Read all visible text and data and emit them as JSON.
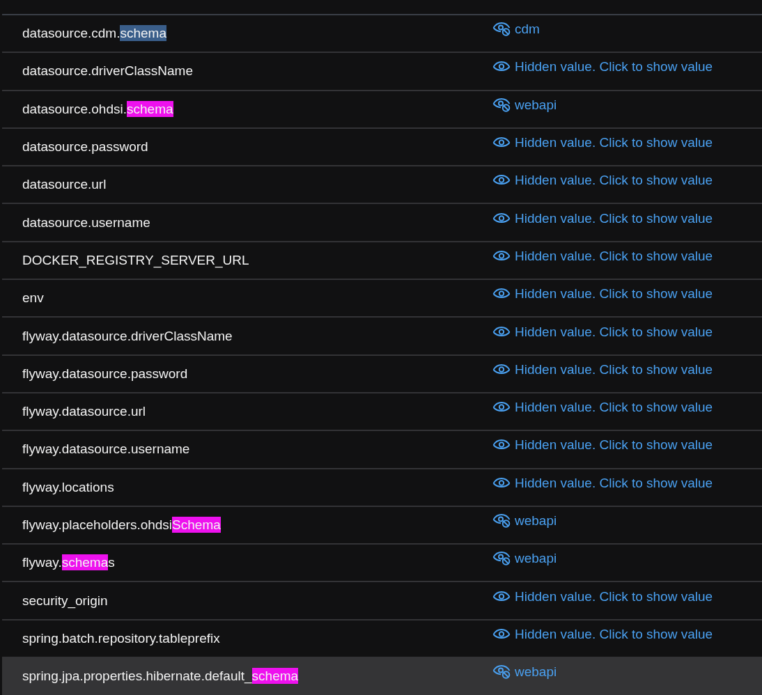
{
  "settings": [
    {
      "selected": false,
      "name": [
        {
          "text": "datasource.cdm.",
          "kind": "plain"
        },
        {
          "text": "schema",
          "kind": "current"
        }
      ],
      "value": {
        "hidden": false,
        "text": "cdm"
      }
    },
    {
      "selected": false,
      "name": [
        {
          "text": "datasource.driverClassName",
          "kind": "plain"
        }
      ],
      "value": {
        "hidden": true,
        "text": "Hidden value. Click to show value"
      }
    },
    {
      "selected": false,
      "name": [
        {
          "text": "datasource.ohdsi.",
          "kind": "plain"
        },
        {
          "text": "schema",
          "kind": "match"
        }
      ],
      "value": {
        "hidden": false,
        "text": "webapi"
      }
    },
    {
      "selected": false,
      "name": [
        {
          "text": "datasource.password",
          "kind": "plain"
        }
      ],
      "value": {
        "hidden": true,
        "text": "Hidden value. Click to show value"
      }
    },
    {
      "selected": false,
      "name": [
        {
          "text": "datasource.url",
          "kind": "plain"
        }
      ],
      "value": {
        "hidden": true,
        "text": "Hidden value. Click to show value"
      }
    },
    {
      "selected": false,
      "name": [
        {
          "text": "datasource.username",
          "kind": "plain"
        }
      ],
      "value": {
        "hidden": true,
        "text": "Hidden value. Click to show value"
      }
    },
    {
      "selected": false,
      "name": [
        {
          "text": "DOCKER_REGISTRY_SERVER_URL",
          "kind": "plain"
        }
      ],
      "value": {
        "hidden": true,
        "text": "Hidden value. Click to show value"
      }
    },
    {
      "selected": false,
      "name": [
        {
          "text": "env",
          "kind": "plain"
        }
      ],
      "value": {
        "hidden": true,
        "text": "Hidden value. Click to show value"
      }
    },
    {
      "selected": false,
      "name": [
        {
          "text": "flyway.datasource.driverClassName",
          "kind": "plain"
        }
      ],
      "value": {
        "hidden": true,
        "text": "Hidden value. Click to show value"
      }
    },
    {
      "selected": false,
      "name": [
        {
          "text": "flyway.datasource.password",
          "kind": "plain"
        }
      ],
      "value": {
        "hidden": true,
        "text": "Hidden value. Click to show value"
      }
    },
    {
      "selected": false,
      "name": [
        {
          "text": "flyway.datasource.url",
          "kind": "plain"
        }
      ],
      "value": {
        "hidden": true,
        "text": "Hidden value. Click to show value"
      }
    },
    {
      "selected": false,
      "name": [
        {
          "text": "flyway.datasource.username",
          "kind": "plain"
        }
      ],
      "value": {
        "hidden": true,
        "text": "Hidden value. Click to show value"
      }
    },
    {
      "selected": false,
      "name": [
        {
          "text": "flyway.locations",
          "kind": "plain"
        }
      ],
      "value": {
        "hidden": true,
        "text": "Hidden value. Click to show value"
      }
    },
    {
      "selected": false,
      "name": [
        {
          "text": "flyway.placeholders.ohdsi",
          "kind": "plain"
        },
        {
          "text": "Schema",
          "kind": "match"
        }
      ],
      "value": {
        "hidden": false,
        "text": "webapi"
      }
    },
    {
      "selected": false,
      "name": [
        {
          "text": "flyway.",
          "kind": "plain"
        },
        {
          "text": "schema",
          "kind": "match"
        },
        {
          "text": "s",
          "kind": "plain"
        }
      ],
      "value": {
        "hidden": false,
        "text": "webapi"
      }
    },
    {
      "selected": false,
      "name": [
        {
          "text": "security_origin",
          "kind": "plain"
        }
      ],
      "value": {
        "hidden": true,
        "text": "Hidden value. Click to show value"
      }
    },
    {
      "selected": false,
      "name": [
        {
          "text": "spring.batch.repository.tableprefix",
          "kind": "plain"
        }
      ],
      "value": {
        "hidden": true,
        "text": "Hidden value. Click to show value"
      }
    },
    {
      "selected": true,
      "name": [
        {
          "text": "spring.jpa.properties.hibernate.default_",
          "kind": "plain"
        },
        {
          "text": "schema",
          "kind": "match"
        }
      ],
      "value": {
        "hidden": false,
        "text": "webapi"
      }
    }
  ]
}
